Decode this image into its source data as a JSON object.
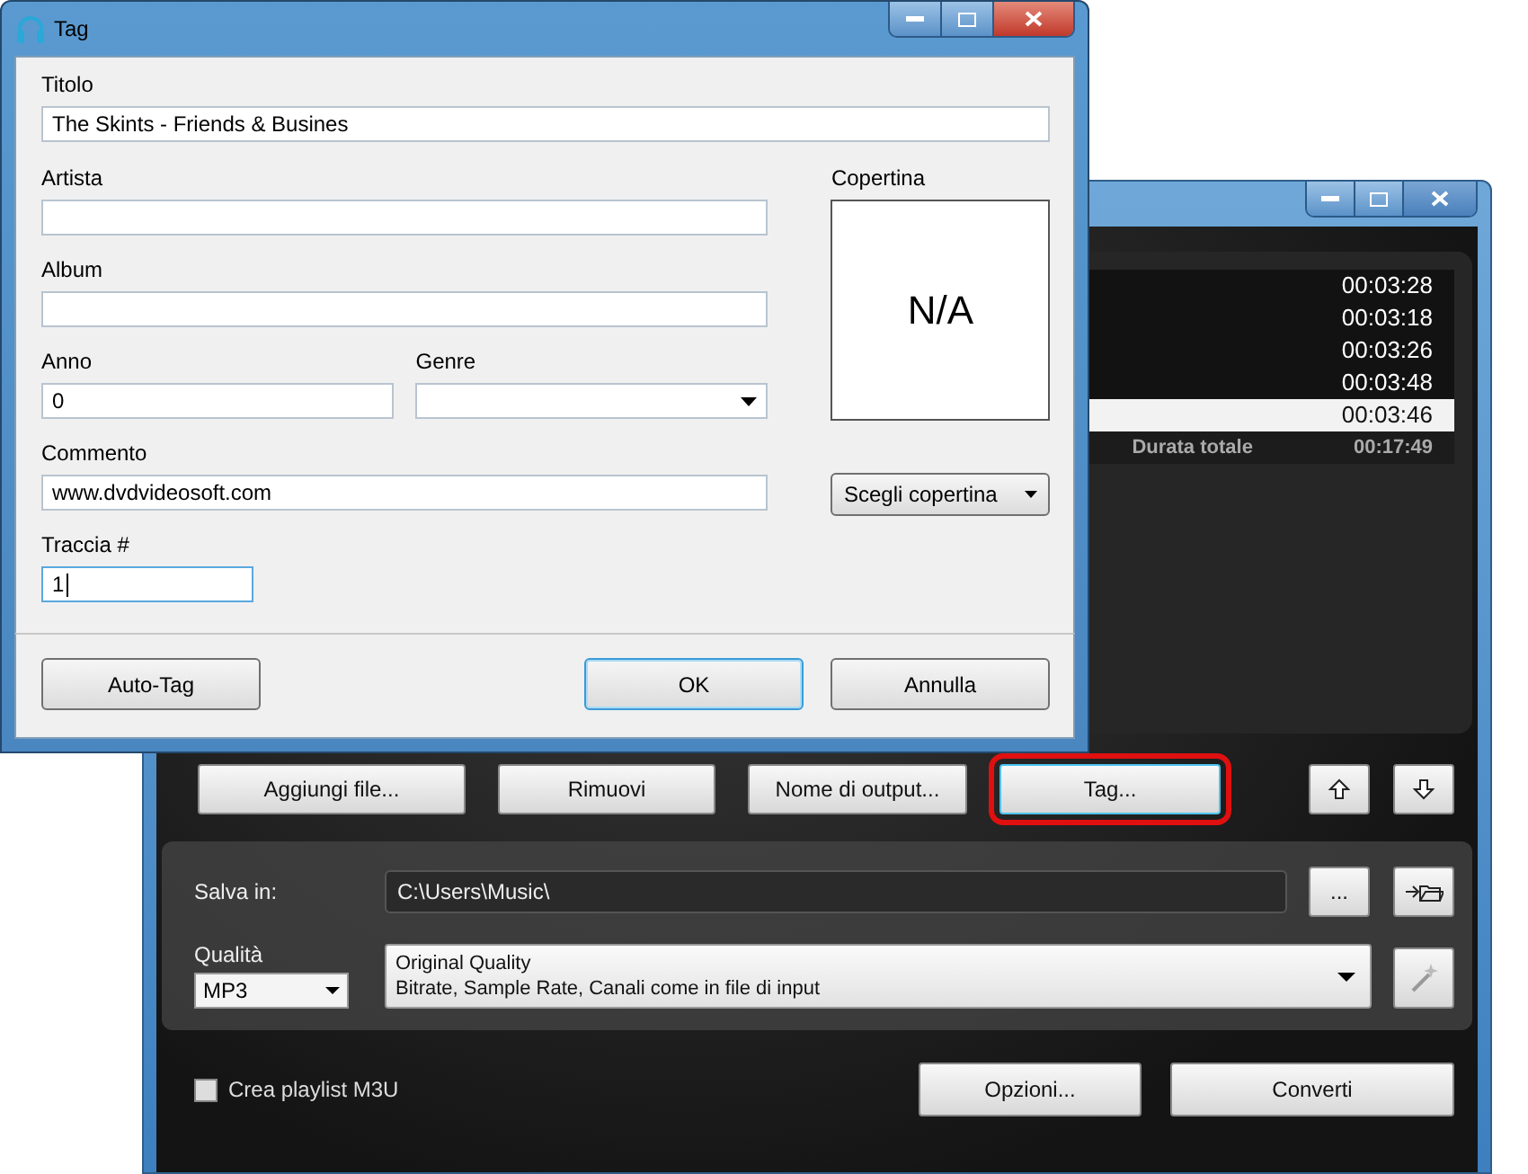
{
  "main_window": {
    "playlist": {
      "rows": [
        {
          "duration": "00:03:28",
          "selected": false
        },
        {
          "duration": "00:03:18",
          "selected": false
        },
        {
          "duration": "00:03:26",
          "selected": false
        },
        {
          "duration": "00:03:48",
          "selected": false
        },
        {
          "duration": "00:03:46",
          "selected": true
        }
      ],
      "total_label": "Durata totale",
      "total": "00:17:49"
    },
    "buttons": [
      {
        "label": "Aggiungi file...",
        "highlighted": false
      },
      {
        "label": "Rimuovi",
        "highlighted": false
      },
      {
        "label": "Nome di output...",
        "highlighted": false
      },
      {
        "label": "Tag...",
        "highlighted": true
      }
    ],
    "save": {
      "label": "Salva in:",
      "path": "C:\\Users\\Music\\",
      "browse": "..."
    },
    "quality": {
      "label": "Qualità",
      "format": "MP3",
      "preset_title": "Original Quality",
      "preset_detail": "Bitrate, Sample Rate, Canali come in file di input"
    },
    "playlist_m3u": {
      "label": "Crea playlist M3U",
      "checked": false
    },
    "actions": [
      "Opzioni...",
      "Converti"
    ]
  },
  "dialog": {
    "title": "Tag",
    "title_field": {
      "label": "Titolo",
      "value": "The Skints - Friends & Busines",
      "focused": false
    },
    "fields": [
      {
        "label": "Artista",
        "focused": false
      },
      {
        "label": "Album",
        "focused": false
      }
    ],
    "year": {
      "label": "Anno",
      "value": "0",
      "focused": false
    },
    "genre": {
      "label": "Genre",
      "focused": false
    },
    "comment": {
      "label": "Commento",
      "value": "www.dvdvideosoft.com",
      "focused": false
    },
    "track": {
      "label": "Traccia #",
      "value": "1",
      "focused": true
    },
    "cover": {
      "label": "Copertina",
      "text": "N/A",
      "button": "Scegli copertina"
    },
    "buttons": [
      {
        "label": "Auto-Tag",
        "default": false
      },
      {
        "label": "OK",
        "default": true
      },
      {
        "label": "Annulla",
        "default": false
      }
    ]
  }
}
